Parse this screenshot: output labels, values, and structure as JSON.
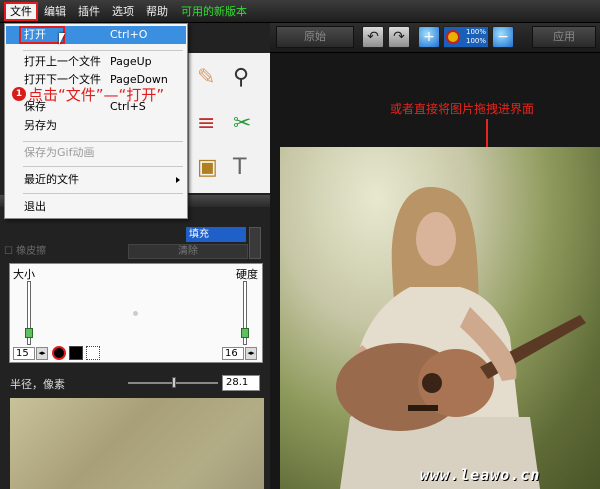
{
  "menubar": {
    "items": [
      "文件",
      "编辑",
      "插件",
      "选项",
      "帮助"
    ],
    "new_version": "可用的新版本"
  },
  "toolbar": {
    "original": "原始",
    "zoom_text": [
      "100%",
      "100%"
    ],
    "apply": "应用"
  },
  "file_menu": {
    "items": [
      {
        "label": "打开",
        "shortcut": "Ctrl+O"
      },
      {
        "label": "打开上一个文件",
        "shortcut": "PageUp"
      },
      {
        "label": "打开下一个文件",
        "shortcut": "PageDown"
      },
      {
        "label": "保存",
        "shortcut": "Ctrl+S"
      },
      {
        "label": "另存为",
        "shortcut": ""
      },
      {
        "label": "保存为Gif动画",
        "shortcut": ""
      },
      {
        "label": "最近的文件",
        "shortcut": ""
      },
      {
        "label": "退出",
        "shortcut": ""
      }
    ]
  },
  "annotation": {
    "step_number": "1",
    "step_text": "点击“文件”—“打开”",
    "drag_hint": "或者直接将图片拖拽进界面"
  },
  "brush_panel": {
    "fill_mode": "填充",
    "eraser": "橡皮擦",
    "clear": "清除",
    "size_label": "大小",
    "hardness_label": "硬度",
    "size_value": "15",
    "hardness_value": "16",
    "radius_label": "半径，像素",
    "radius_value": "28.1"
  },
  "watermark": "www.leawo.cn",
  "colors": {
    "accent_red": "#e01c1c",
    "selection_blue": "#3a8fe0",
    "new_version_green": "#2ee02e"
  }
}
